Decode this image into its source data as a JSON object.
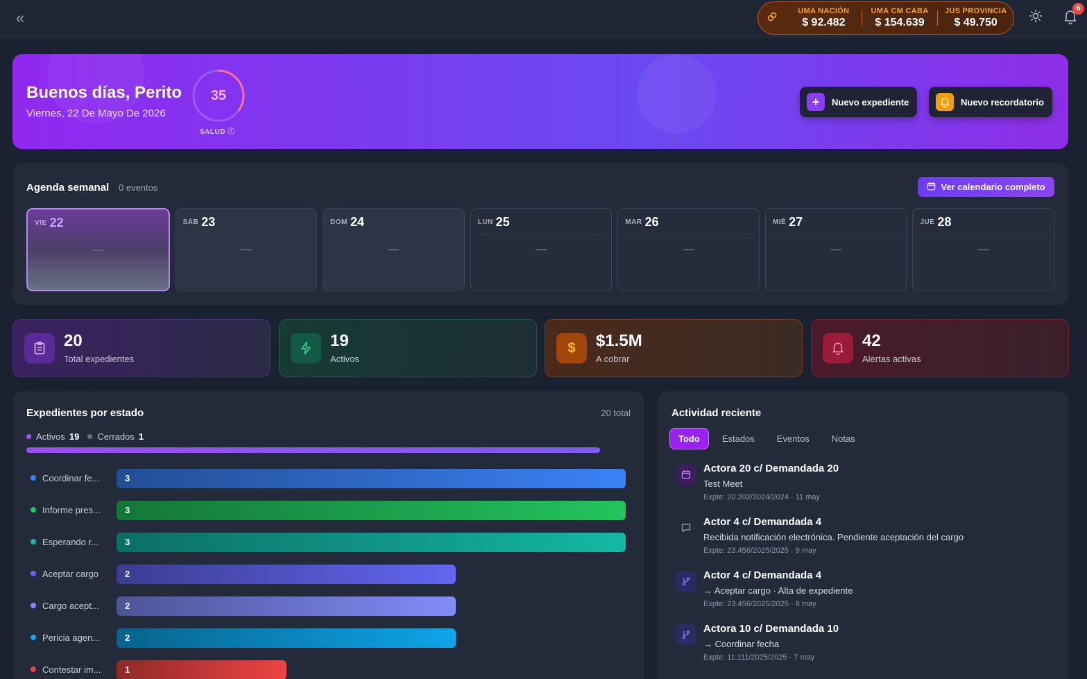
{
  "topbar": {
    "uma": [
      {
        "label": "UMA NACIÓN",
        "value": "$ 92.482"
      },
      {
        "label": "UMA CM CABA",
        "value": "$ 154.639"
      },
      {
        "label": "JUS PROVINCIA",
        "value": "$ 49.750"
      }
    ],
    "notifications_count": "6"
  },
  "hero": {
    "greeting": "Buenos días, Perito",
    "date": "Viernes, 22 De Mayo De 2026",
    "health_score": "35",
    "health_score_value": 35,
    "health_label": "SALUD",
    "btn_new_case": "Nuevo expediente",
    "btn_new_reminder": "Nuevo recordatorio"
  },
  "agenda": {
    "title": "Agenda semanal",
    "count": "0 eventos",
    "calendar_button": "Ver calendario completo",
    "days": [
      {
        "wd": "VIE",
        "num": "22",
        "empty": "—"
      },
      {
        "wd": "SÁB",
        "num": "23",
        "empty": "—"
      },
      {
        "wd": "DOM",
        "num": "24",
        "empty": "—"
      },
      {
        "wd": "LUN",
        "num": "25",
        "empty": "—"
      },
      {
        "wd": "MAR",
        "num": "26",
        "empty": "—"
      },
      {
        "wd": "MIÉ",
        "num": "27",
        "empty": "—"
      },
      {
        "wd": "JUE",
        "num": "28",
        "empty": "—"
      }
    ]
  },
  "stats": [
    {
      "value": "20",
      "label": "Total expedientes"
    },
    {
      "value": "19",
      "label": "Activos"
    },
    {
      "value": "$1.5M",
      "label": "A cobrar"
    },
    {
      "value": "42",
      "label": "Alertas activas"
    }
  ],
  "estado": {
    "title": "Expedientes por estado",
    "total": "20 total",
    "legend_active_label": "Activos",
    "legend_active_value": "19",
    "legend_closed_label": "Cerrados",
    "legend_closed_value": "1",
    "active_fraction": 0.95
  },
  "chart_data": {
    "type": "bar",
    "orientation": "horizontal",
    "categories": [
      "Coordinar fe...",
      "Informe pres...",
      "Esperando r...",
      "Aceptar cargo",
      "Cargo acept...",
      "Pericia agen...",
      "Contestar im..."
    ],
    "values": [
      3,
      3,
      3,
      2,
      2,
      2,
      1
    ],
    "colors": [
      "#3b82f6",
      "#22c55e",
      "#14b8a6",
      "#6366f1",
      "#818cf8",
      "#0ea5e9",
      "#ef4444"
    ],
    "xlim": [
      0,
      3
    ]
  },
  "activity": {
    "title": "Actividad reciente",
    "tabs": [
      "Todo",
      "Estados",
      "Eventos",
      "Notas"
    ],
    "items": [
      {
        "icon": "calendar-icon",
        "title": "Actora 20 c/ Demandada 20",
        "subtitle": "Test Meet",
        "meta": "Expte: 20.202/2024/2024 · 11 may"
      },
      {
        "icon": "comment-icon",
        "title": "Actor 4 c/ Demandada 4",
        "subtitle": "Recibida notificación electrónica. Pendiente aceptación del cargo",
        "meta": "Expte: 23.456/2025/2025 · 9 may"
      },
      {
        "icon": "branch-icon",
        "title": "Actor 4 c/ Demandada 4",
        "subtitle": "→ Aceptar cargo · Alta de expediente",
        "meta": "Expte: 23.456/2025/2025 · 8 may"
      },
      {
        "icon": "branch-icon",
        "title": "Actora 10 c/ Demandada 10",
        "subtitle": "→ Coordinar fecha",
        "meta": "Expte: 11.111/2025/2025 · 7 may"
      }
    ]
  }
}
